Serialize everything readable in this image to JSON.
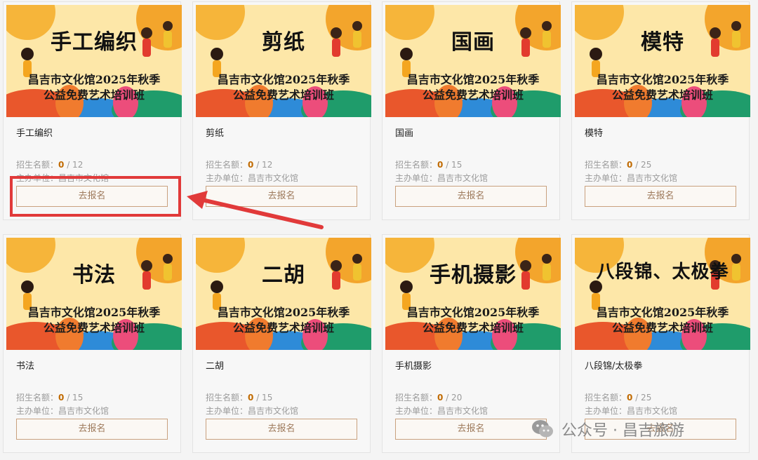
{
  "banner_subtitle_line1": "昌吉市文化馆2025年秋季",
  "banner_subtitle_line2": "公益免费艺术培训班",
  "labels": {
    "quota_prefix": "招生名额：",
    "host_prefix": "主办单位：",
    "signup": "去报名"
  },
  "courses": [
    {
      "banner_title": "手工编织",
      "title": "手工编织",
      "enrolled": "0",
      "capacity": "/ 12",
      "host": "昌吉市文化馆"
    },
    {
      "banner_title": "剪纸",
      "title": "剪纸",
      "enrolled": "0",
      "capacity": "/ 12",
      "host": "昌吉市文化馆"
    },
    {
      "banner_title": "国画",
      "title": "国画",
      "enrolled": "0",
      "capacity": "/ 15",
      "host": "昌吉市文化馆"
    },
    {
      "banner_title": "模特",
      "title": "模特",
      "enrolled": "0",
      "capacity": "/ 25",
      "host": "昌吉市文化馆"
    },
    {
      "banner_title": "书法",
      "title": "书法",
      "enrolled": "0",
      "capacity": "/ 15",
      "host": "昌吉市文化馆"
    },
    {
      "banner_title": "二胡",
      "title": "二胡",
      "enrolled": "0",
      "capacity": "/ 15",
      "host": "昌吉市文化馆"
    },
    {
      "banner_title": "手机摄影",
      "title": "手机摄影",
      "enrolled": "0",
      "capacity": "/ 20",
      "host": "昌吉市文化馆"
    },
    {
      "banner_title": "八段锦、太极拳",
      "title": "八段锦/太极拳",
      "enrolled": "0",
      "capacity": "/ 25",
      "host": "昌吉市文化馆"
    }
  ],
  "watermark": {
    "text": "公众号 · 昌吉旅游",
    "icon": "wechat-icon"
  },
  "colors": {
    "highlight": "#e13a3a",
    "button_border": "#c9a17e",
    "quota_number": "#c06a00"
  }
}
